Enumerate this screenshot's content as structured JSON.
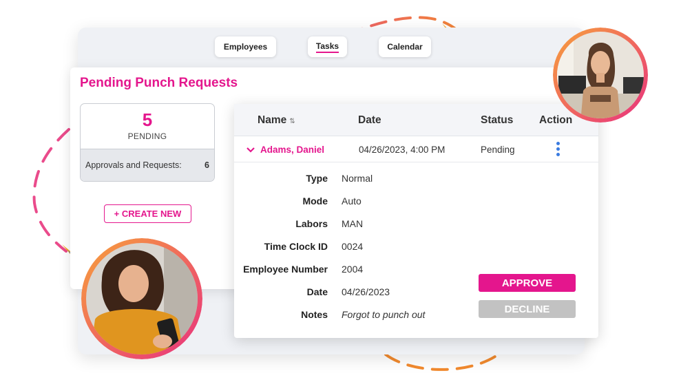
{
  "tabs": [
    {
      "label": "Employees",
      "active": false
    },
    {
      "label": "Tasks",
      "active": true
    },
    {
      "label": "Calendar",
      "active": false
    }
  ],
  "page_title": "Pending Punch Requests",
  "summary": {
    "count": "5",
    "count_label": "PENDING",
    "approvals_label": "Approvals and Requests:",
    "approvals_count": "6"
  },
  "create_button": "+ CREATE NEW",
  "table": {
    "headers": {
      "name": "Name",
      "date": "Date",
      "status": "Status",
      "action": "Action"
    },
    "row": {
      "name": "Adams, Daniel",
      "date": "04/26/2023, 4:00 PM",
      "status": "Pending"
    }
  },
  "details": [
    {
      "label": "Type",
      "value": "Normal"
    },
    {
      "label": "Mode",
      "value": "Auto"
    },
    {
      "label": "Labors",
      "value": "MAN"
    },
    {
      "label": "Time Clock ID",
      "value": "0024"
    },
    {
      "label": "Employee Number",
      "value": "2004"
    },
    {
      "label": "Date",
      "value": "04/26/2023"
    },
    {
      "label": "Notes",
      "value": "Forgot to punch out"
    }
  ],
  "approve_button": "APPROVE",
  "decline_button": "DECLINE",
  "icons": {
    "sort": "sort-arrows-icon",
    "expand": "chevron-down-icon",
    "action": "kebab-menu-icon"
  },
  "colors": {
    "accent": "#e4168d",
    "action_dots": "#3a7be0",
    "decline": "#c2c2c2",
    "dash_pink": "#ea4b8b",
    "dash_orange": "#f28a2e"
  }
}
